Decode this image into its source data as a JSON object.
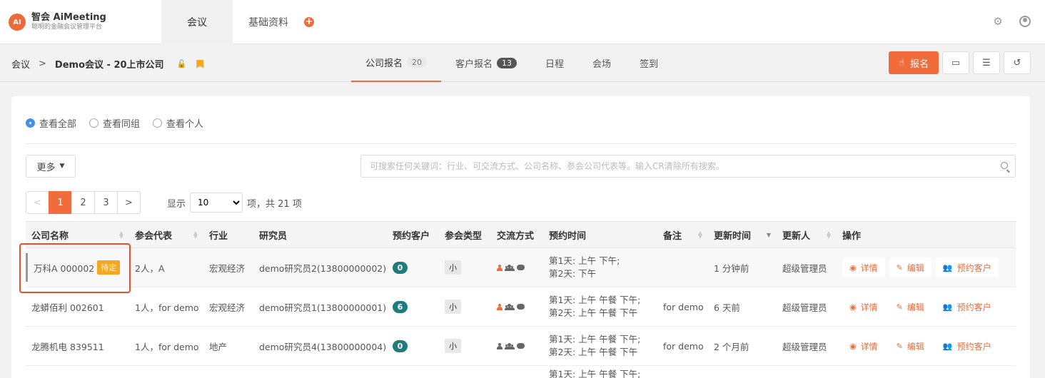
{
  "brand": {
    "mark": "AI",
    "title": "智会 AiMeeting",
    "subtitle": "聪明的金融会议管理平台"
  },
  "topnav": {
    "tabs": [
      "会议",
      "基础资料"
    ],
    "add": "+"
  },
  "breadcrumb": {
    "root": "会议",
    "sep": ">",
    "current": "Demo会议 - 20上市公司"
  },
  "subtabs": [
    {
      "label": "公司报名",
      "badge": "20"
    },
    {
      "label": "客户报名",
      "badge": "13"
    },
    {
      "label": "日程"
    },
    {
      "label": "会场"
    },
    {
      "label": "签到"
    }
  ],
  "actions": {
    "register": "报名"
  },
  "filters": {
    "all": "查看全部",
    "group": "查看同组",
    "personal": "查看个人"
  },
  "more": "更多",
  "search": {
    "placeholder": "可搜索任何关键词：行业、可交流方式、公司名称、参会公司代表等。输入CR清除所有搜索。"
  },
  "pagination": {
    "prev": "<",
    "pages": [
      "1",
      "2",
      "3"
    ],
    "next": ">",
    "show": "显示",
    "size": "10",
    "suffix": "项，共 21 项"
  },
  "table": {
    "headers": [
      "公司名称",
      "参会代表",
      "行业",
      "研究员",
      "预约客户",
      "参会类型",
      "交流方式",
      "预约时间",
      "备注",
      "更新时间",
      "更新人",
      "操作"
    ],
    "rows": [
      {
        "company": "万科A 000002",
        "status": "待定",
        "reps": "2人，A",
        "industry": "宏观经济",
        "researcher": "demo研究员2(13800000002)",
        "clients": "0",
        "type": "小",
        "time1": "第1天: 上午 下午;",
        "time2": "第2天: 下午",
        "note": "",
        "updated": "1 分钟前",
        "updater": "超级管理员"
      },
      {
        "company": "龙蟒佰利 002601",
        "status": "",
        "reps": "1人，for demo",
        "industry": "宏观经济",
        "researcher": "demo研究员1(13800000001)",
        "clients": "6",
        "type": "小",
        "time1": "第1天: 上午 午餐 下午;",
        "time2": "第2天: 上午 午餐 下午",
        "note": "for demo",
        "updated": "6 天前",
        "updater": "超级管理员"
      },
      {
        "company": "龙腾机电 839511",
        "status": "",
        "reps": "1人，for demo",
        "industry": "地产",
        "researcher": "demo研究员4(13800000004)",
        "clients": "0",
        "type": "小",
        "time1": "第1天: 上午 午餐 下午;",
        "time2": "第2天: 上午 午餐 下午",
        "note": "for demo",
        "updated": "2 个月前",
        "updater": "超级管理员"
      }
    ],
    "ops": {
      "detail": "详情",
      "edit": "编辑",
      "reserve": "预约客户"
    },
    "partial_row": "第1天: 上午 午餐 下午;"
  },
  "colors": {
    "accent": "#f26b3a",
    "pending": "#f5a623",
    "count_badge": "#1e7c7e"
  },
  "icons": [
    "gear-icon",
    "user-icon",
    "lock-icon",
    "bookmark-icon",
    "hand-icon",
    "monitor-icon",
    "sliders-icon",
    "history-icon",
    "search-icon",
    "eye-icon",
    "edit-icon",
    "users-icon"
  ]
}
